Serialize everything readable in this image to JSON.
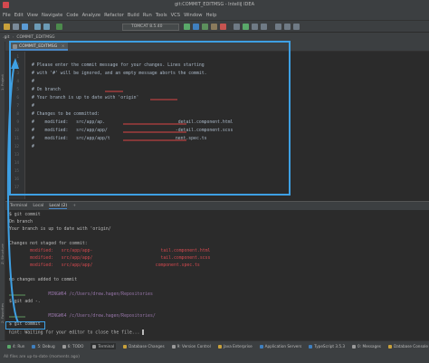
{
  "window": {
    "title": "git:COMMIT_EDITMSG - IntelliJ IDEA"
  },
  "menu": [
    "File",
    "Edit",
    "View",
    "Navigate",
    "Code",
    "Analyze",
    "Refactor",
    "Build",
    "Run",
    "Tools",
    "VCS",
    "Window",
    "Help"
  ],
  "toolbar": {
    "run_config": "TOMCAT 8.5.40"
  },
  "breadcrumbs": [
    ".git",
    "COMMIT_EDITMSG"
  ],
  "editor": {
    "tab_label": "COMMIT_EDITMSG",
    "line_numbers": [
      "1",
      "2",
      "3",
      "4",
      "5",
      "6",
      "7",
      "8",
      "9",
      "10",
      "11",
      "12",
      "13",
      "14",
      "15",
      "16",
      "17"
    ],
    "lines": [
      "",
      "# Please enter the commit message for your changes. Lines starting",
      "# with '#' will be ignored, and an empty message aborts the commit.",
      "#",
      "# On branch",
      "# Your branch is up to date with 'origin'",
      "#",
      "# Changes to be committed:",
      "#    modified:   src/app/ap.                            detail.component.html",
      "#    modified:   src/app/app/                          -detail.component.scss",
      "#    modified:   src/app/app/t                         nent.spec.ts",
      "#",
      "",
      "",
      "",
      "",
      ""
    ]
  },
  "terminal": {
    "tabs": [
      "Terminal",
      "Local",
      "Local (2)"
    ],
    "lines": [
      {
        "text": "$ git commit",
        "style": ""
      },
      {
        "text": "On branch",
        "style": ""
      },
      {
        "text": "Your branch is up to date with 'origin/",
        "style": ""
      },
      {
        "text": "",
        "style": ""
      },
      {
        "text": "Changes not staged for commit:",
        "style": ""
      },
      {
        "text": "        modified:   src/app/app-                          tail.component.html",
        "style": "term-red"
      },
      {
        "text": "        modified:   src/app/app/                          tail.component.scss",
        "style": "term-red"
      },
      {
        "text": "        modified:   src/app/app/                        component.spec.ts",
        "style": "term-red"
      },
      {
        "text": "",
        "style": ""
      },
      {
        "text": "no changes added to commit",
        "style": ""
      },
      {
        "text": "",
        "style": ""
      },
      {
        "text": "               MINGW64 /c/Users/drew.hagen/Repositories",
        "style": "term-purple"
      },
      {
        "text": "$ git add -.",
        "style": ""
      },
      {
        "text": "",
        "style": ""
      },
      {
        "text": "               MINGW64 /c/Users/drew.hagen/Repositories/",
        "style": "term-purple"
      },
      {
        "text": "$ git commit",
        "style": ""
      },
      {
        "text": "hint: Waiting for your editor to close the file...",
        "style": ""
      }
    ]
  },
  "left_strip_tabs": [
    "1: Project",
    "2: Favorites",
    "Z: Structure"
  ],
  "bottom_tools": [
    "4: Run",
    "5: Debug",
    "6: TODO",
    "Terminal",
    "Database Changes",
    "9: Version Control",
    "Java Enterprise",
    "Application Servers",
    "TypeScript 3.5.3",
    "0: Messages",
    "Database Console"
  ],
  "status": {
    "message": "All files are up-to-date (moments ago)"
  },
  "colors": {
    "accent": "#3ea0e4",
    "bg": "#2b2b2b",
    "panel": "#3c3f41"
  }
}
